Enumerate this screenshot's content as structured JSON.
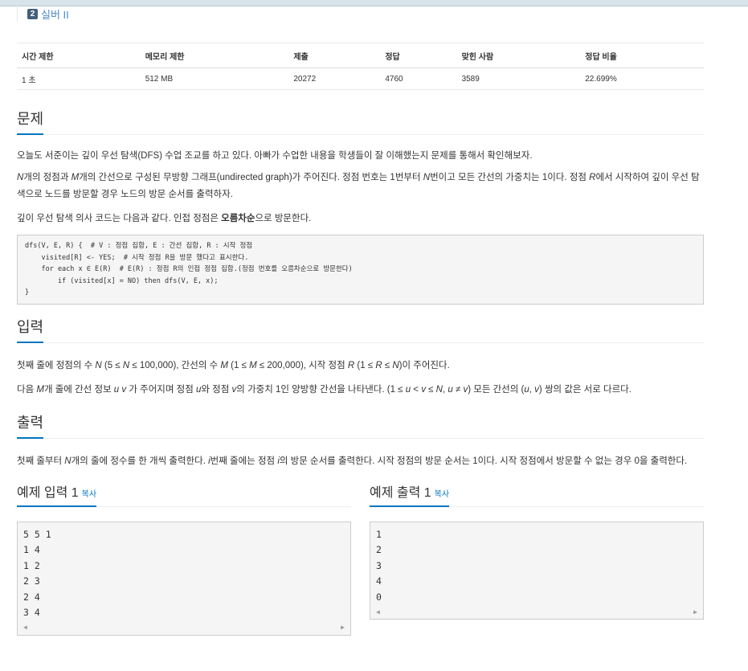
{
  "tier": {
    "badge": "2",
    "label": "실버 II"
  },
  "info_table": {
    "headers": [
      "시간 제한",
      "메모리 제한",
      "제출",
      "정답",
      "맞힌 사람",
      "정답 비율"
    ],
    "values": [
      "1 초",
      "512 MB",
      "20272",
      "4760",
      "3589",
      "22.699%"
    ]
  },
  "problem": {
    "title": "문제",
    "p1": "오늘도 서준이는 깊이 우선 탐색(DFS) 수업 조교를 하고 있다. 아빠가 수업한 내용을 학생들이 잘 이해했는지 문제를 통해서 확인해보자.",
    "p2": {
      "N": "N",
      "t1": "개의 정점과 ",
      "M": "M",
      "t2": "개의 간선으로 구성된 무방향 그래프(undirected graph)가 주어진다. 정점 번호는 1번부터 ",
      "N2": "N",
      "t3": "번이고 모든 간선의 가중치는 1이다. 정점 ",
      "R": "R",
      "t4": "에서 시작하여 깊이 우선 탐색으로 노드를 방문할 경우 노드의 방문 순서를 출력하자."
    },
    "p3": {
      "t1": "깊이 우선 탐색 의사 코드는 다음과 같다. 인접 정점은 ",
      "bold": "오름차순",
      "t2": "으로 방문한다."
    },
    "code": [
      "dfs(V, E, R) {  # V : 정점 집합, E : 간선 집합, R : 시작 정점",
      "    visited[R] <- YES;  # 시작 정점 R을 방문 했다고 표시한다.",
      "    for each x ∈ E(R)  # E(R) : 정점 R의 인접 정점 집합.(정점 번호를 오름차순으로 방문한다)",
      "        if (visited[x] = NO) then dfs(V, E, x);",
      "}"
    ]
  },
  "input": {
    "title": "입력",
    "p1": {
      "t1": "첫째 줄에 정점의 수 ",
      "N": "N",
      "t2": " (5 ≤ ",
      "N2": "N",
      "t3": " ≤ 100,000), 간선의 수 ",
      "M": "M",
      "t4": " (1 ≤ ",
      "M2": "M",
      "t5": " ≤ 200,000), 시작 정점 ",
      "R": "R",
      "t6": " (1 ≤ ",
      "R2": "R",
      "t7": " ≤ ",
      "N3": "N",
      "t8": ")이 주어진다."
    },
    "p2": {
      "t1": "다음 ",
      "M": "M",
      "t2": "개 줄에 간선 정보 ",
      "u": "u",
      "sp": " ",
      "v": "v",
      "t3": " 가 주어지며 정점 ",
      "u2": "u",
      "t4": "와 정점 ",
      "v2": "v",
      "t5": "의 가중치 1인 양방향 간선을 나타낸다. (1 ≤ ",
      "u3": "u",
      "t6": " < ",
      "v3": "v",
      "t7": " ≤ ",
      "N": "N",
      "t8": ", ",
      "u4": "u",
      "t9": " ≠ ",
      "v4": "v",
      "t10": ") 모든 간선의 (",
      "u5": "u",
      "t11": ", ",
      "v5": "v",
      "t12": ") 쌍의 값은 서로 다르다."
    }
  },
  "output": {
    "title": "출력",
    "p1": {
      "t1": "첫째 줄부터 ",
      "N": "N",
      "t2": "개의 줄에 정수를 한 개씩 출력한다. ",
      "i": "i",
      "t3": "번째 줄에는 정점 ",
      "i2": "i",
      "t4": "의 방문 순서를 출력한다. 시작 정점의 방문 순서는 1이다. 시작 정점에서 방문할 수 없는 경우 0을 출력한다."
    }
  },
  "sample_input": {
    "title": "예제 입력 1",
    "copy": "복사",
    "lines": [
      "5 5 1",
      "1 4",
      "1 2",
      "2 3",
      "2 4",
      "3 4"
    ]
  },
  "sample_output": {
    "title": "예제 출력 1",
    "copy": "복사",
    "lines": [
      "1",
      "2",
      "3",
      "4",
      "0"
    ]
  },
  "scroll": {
    "left": "◀",
    "right": "▶"
  }
}
